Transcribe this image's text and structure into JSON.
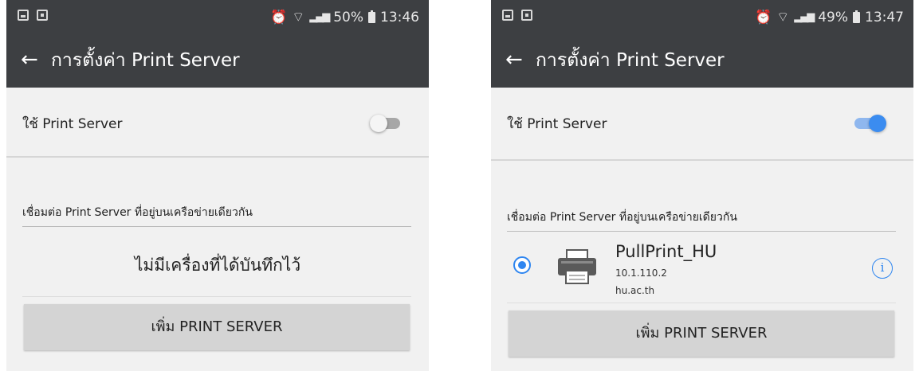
{
  "left": {
    "status": {
      "alarm": "⏰",
      "wifi": "⌔",
      "signal": "▂▄▆",
      "battery": "50%",
      "time": "13:46"
    },
    "appbar": {
      "back": "←",
      "title": "การตั้งค่า Print Server"
    },
    "toggle": {
      "label": "ใช้ Print Server",
      "state": "off"
    },
    "section_label": "เชื่อมต่อ Print Server ที่อยู่บนเครือข่ายเดียวกัน",
    "empty_message": "ไม่มีเครื่องที่ได้บันทึกไว้",
    "add_button": "เพิ่ม PRINT SERVER"
  },
  "right": {
    "status": {
      "alarm": "⏰",
      "wifi": "⌔",
      "signal": "▂▄▆",
      "battery": "49%",
      "time": "13:47"
    },
    "appbar": {
      "back": "←",
      "title": "การตั้งค่า Print Server"
    },
    "toggle": {
      "label": "ใช้ Print Server",
      "state": "on"
    },
    "section_label": "เชื่อมต่อ Print Server ที่อยู่บนเครือข่ายเดียวกัน",
    "server": {
      "name": "PullPrint_HU",
      "ip": "10.1.110.2",
      "domain": "hu.ac.th",
      "selected": true,
      "info": "i"
    },
    "add_button": "เพิ่ม PRINT SERVER"
  },
  "colors": {
    "appbar": "#3d3f42",
    "accent": "#3b8cf0",
    "button": "#d4d4d4",
    "background": "#f1f1f1"
  }
}
